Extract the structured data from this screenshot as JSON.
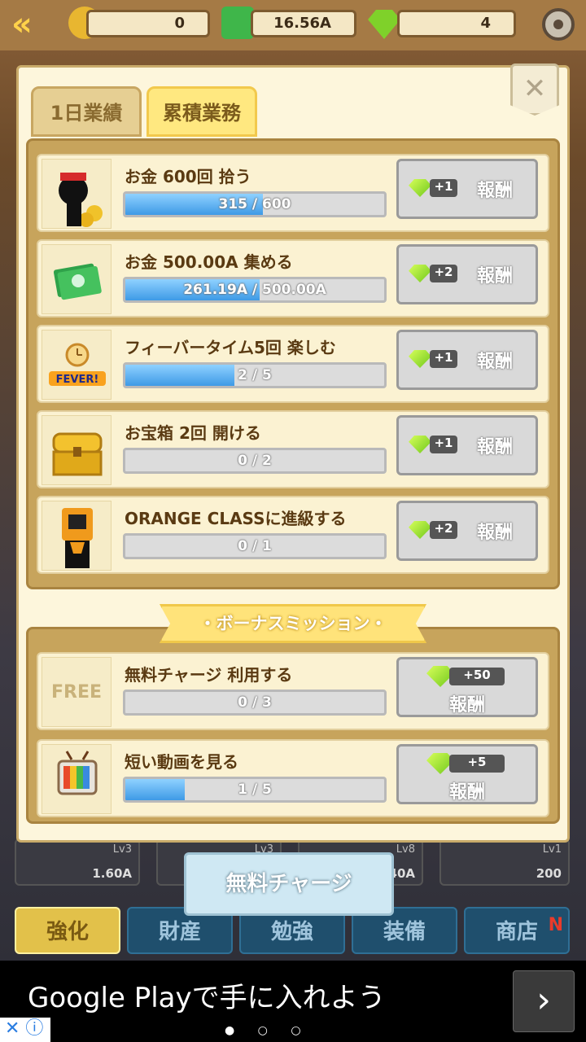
{
  "top": {
    "medal_count": "0",
    "money": "16.56A",
    "gems": "4"
  },
  "tabs": {
    "daily": "1日業績",
    "cumulative": "累積業務"
  },
  "close_label": "✕",
  "missions": [
    {
      "title": "お金 600回 拾う",
      "progress": "315 / 600",
      "fill": 0.53,
      "reward": "+1",
      "button": "報酬",
      "icon": "ninja-coins-icon"
    },
    {
      "title": "お金 500.00A 集める",
      "progress": "261.19A / 500.00A",
      "fill": 0.52,
      "reward": "+2",
      "button": "報酬",
      "icon": "cash-icon"
    },
    {
      "title": "フィーバータイム5回 楽しむ",
      "progress": "2 / 5",
      "fill": 0.4,
      "reward": "+1",
      "button": "報酬",
      "icon": "fever-clock-icon"
    },
    {
      "title": "お宝箱 2回 開ける",
      "progress": "0 / 2",
      "fill": 0,
      "reward": "+1",
      "button": "報酬",
      "icon": "treasure-chest-icon"
    },
    {
      "title": "ORANGE CLASSに進級する",
      "progress": "0 / 1",
      "fill": 0,
      "reward": "+2",
      "button": "報酬",
      "icon": "orange-class-icon"
    }
  ],
  "bonus_title": "・ボーナスミッション・",
  "bonus": [
    {
      "title": "無料チャージ 利用する",
      "progress": "0 / 3",
      "fill": 0,
      "reward": "+50",
      "button": "報酬",
      "icon_text": "FREE"
    },
    {
      "title": "短い動画を見る",
      "progress": "1 / 5",
      "fill": 0.2,
      "reward": "+5",
      "button": "報酬",
      "icon": "tv-icon"
    }
  ],
  "bottom_cards": [
    {
      "lv": "Lv3",
      "value": "1.60A"
    },
    {
      "lv": "Lv3",
      "value": "40A"
    },
    {
      "lv": "Lv8",
      "value": ""
    },
    {
      "lv": "Lv1",
      "value": "200"
    }
  ],
  "free_charge": "無料チャージ",
  "nav": [
    "強化",
    "財産",
    "勉強",
    "装備",
    "商店"
  ],
  "nav_badge": "N",
  "ad": {
    "text": "Google Playで手に入れよう",
    "arrow": "›",
    "dots": "● ○ ○"
  }
}
